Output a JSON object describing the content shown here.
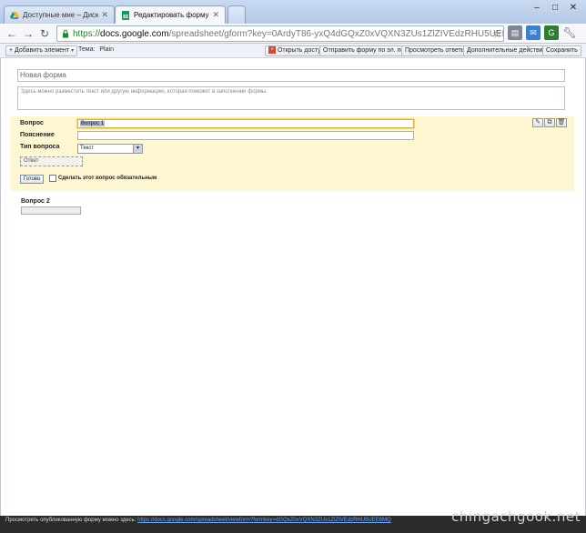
{
  "browser": {
    "tabs": [
      {
        "label": "Доступные мне – Диск Goog",
        "close": "✕"
      },
      {
        "label": "Редактировать форму – Фо",
        "close": "✕"
      }
    ],
    "url": {
      "scheme": "https://",
      "host": "docs.google.com",
      "path": "/spreadsheet/gform?key=0ArdyT86-yxQ4dGQxZ0xVQXN3ZUs1ZlZIVEdzRHU5UEE&hl=ru"
    },
    "window_controls": {
      "minimize": "–",
      "maximize": "□",
      "close": "✕"
    }
  },
  "docs_toolbar": {
    "add_item": "Добавить элемент",
    "theme_label": "Тема:",
    "theme_value": "Plain",
    "share": "Открыть доступ",
    "email_form": "Отправить форму по эл. почте",
    "view_responses": "Просмотреть ответы",
    "more_actions": "Дополнительные действия",
    "save": "Сохранить"
  },
  "form": {
    "title": "Новая форма",
    "description": "Здесь можно разместить текст или другую информацию, которая поможет в заполнении формы."
  },
  "question_editor": {
    "question_label": "Вопрос",
    "question_value": "Вопрос 1",
    "help_label": "Пояснение",
    "help_value": "",
    "type_label": "Тип вопроса",
    "type_value": "Текст",
    "answer_placeholder": "Ответ",
    "done": "Готово",
    "required_label": "Сделать этот вопрос обязательным"
  },
  "question2": {
    "label": "Вопрос 2"
  },
  "status": {
    "text": "Просмотреть опубликованную форму можно здесь:",
    "link": "https://docs.google.com/spreadsheet/viewform?formkey=dGQxZ0xVQXN3ZUs1ZlZIVEdzRHU5UEE6MQ"
  },
  "watermark": "chingachgook.net",
  "colors": {
    "accent_blue": "#dbe5f3",
    "question_highlight": "#fff6d2",
    "url_scheme": "#1a8a24",
    "status_link": "#6aa8ff"
  }
}
